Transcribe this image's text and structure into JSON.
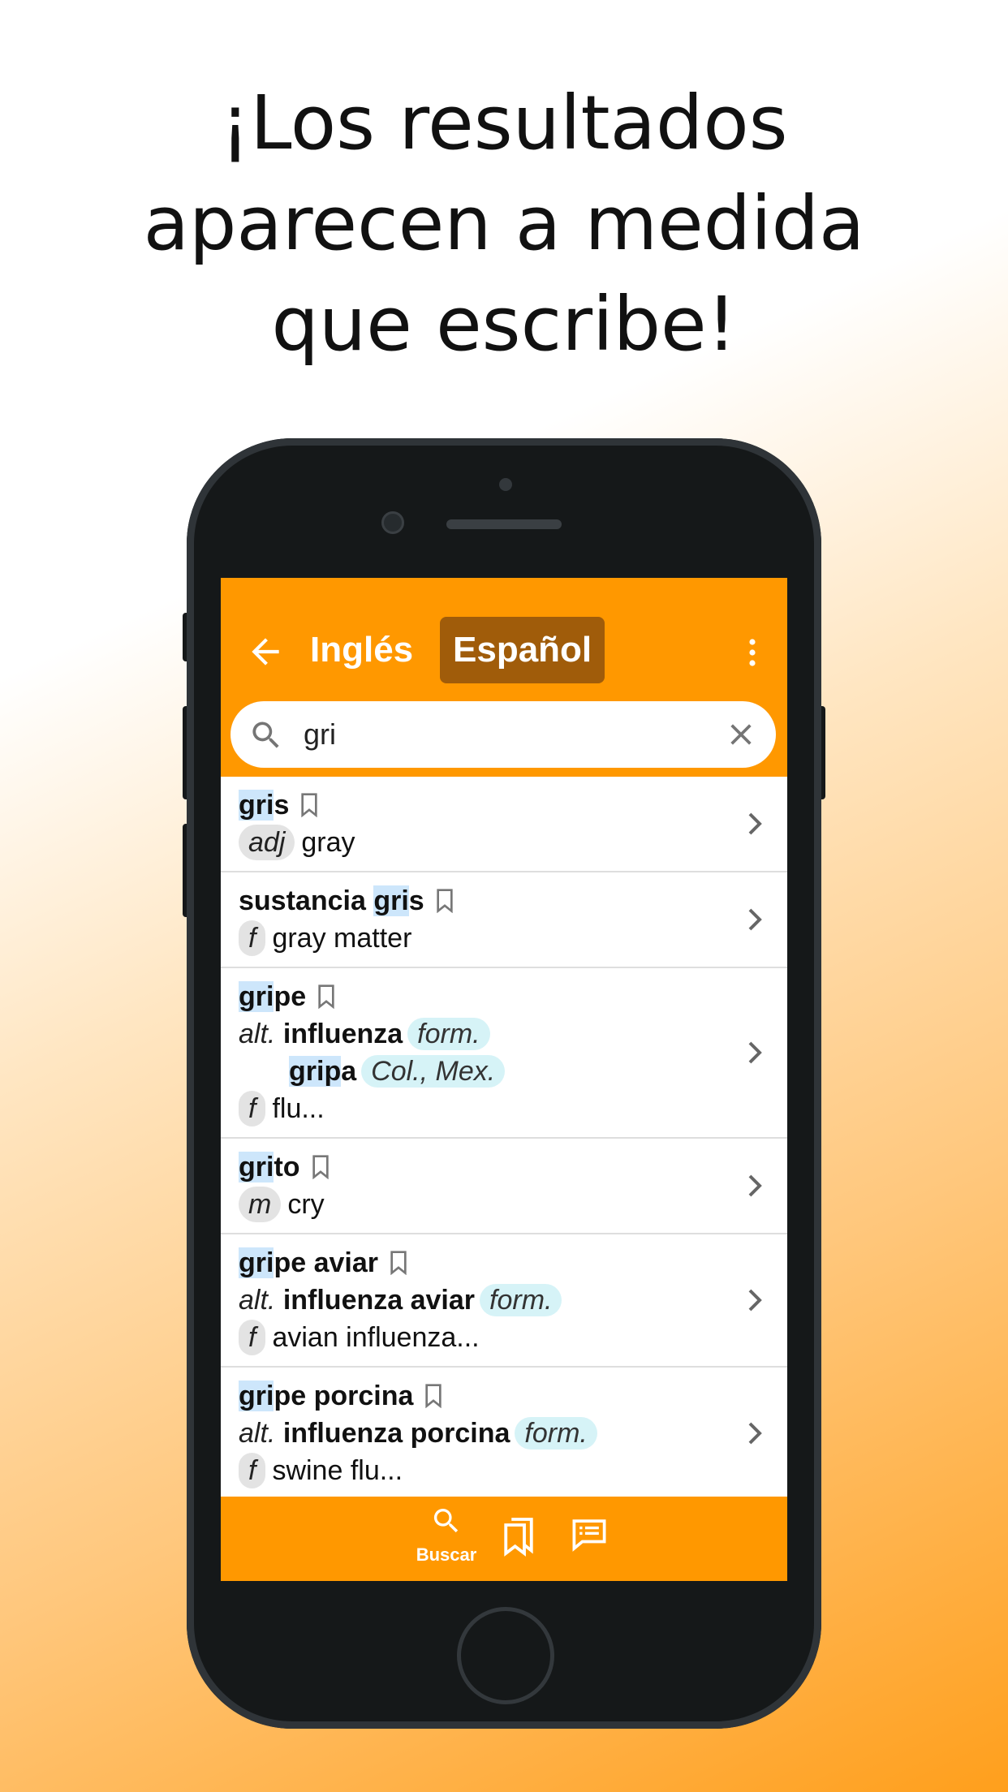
{
  "headline": [
    "¡Los resultados",
    "aparecen a medida",
    "que escribe!"
  ],
  "header": {
    "lang_source": "Inglés",
    "lang_target": "Español",
    "back_icon": "arrow-left-icon",
    "menu_icon": "more-vertical-icon"
  },
  "search": {
    "value": "gri",
    "icon": "search-icon",
    "clear_icon": "close-icon"
  },
  "results": [
    {
      "hl": "gri",
      "rest": "s",
      "pos": "adj",
      "translation": "gray"
    },
    {
      "pre": "sustancia ",
      "hl": "gri",
      "rest": "s",
      "pos": "f",
      "translation": "gray matter"
    },
    {
      "hl": "gri",
      "rest": "pe",
      "alt_label": "alt.",
      "alt1": "influenza",
      "alt1_note": "form.",
      "alt2_hl": "grip",
      "alt2_rest": "a",
      "alt2_note": "Col., Mex.",
      "pos": "f",
      "translation": "flu..."
    },
    {
      "hl": "gri",
      "rest": "to",
      "pos": "m",
      "translation": "cry"
    },
    {
      "hl": "gri",
      "rest": "pe aviar",
      "alt_label": "alt.",
      "alt1": "influenza aviar",
      "alt1_note": "form.",
      "pos": "f",
      "translation": "avian influenza..."
    },
    {
      "hl": "gri",
      "rest": "pe porcina",
      "alt_label": "alt.",
      "alt1": "influenza porcina",
      "alt1_note": "form.",
      "pos": "f",
      "translation": "swine flu..."
    }
  ],
  "nav": {
    "search_label": "Buscar",
    "search_icon": "search-icon",
    "bookmarks_icon": "bookmarks-icon",
    "list_icon": "list-icon"
  },
  "colors": {
    "accent": "#ff9800",
    "active_lang_bg": "#a05c0a",
    "highlight": "#cde6fb",
    "pos_badge": "#e3e3e3",
    "note_badge": "#d6f3f7"
  }
}
